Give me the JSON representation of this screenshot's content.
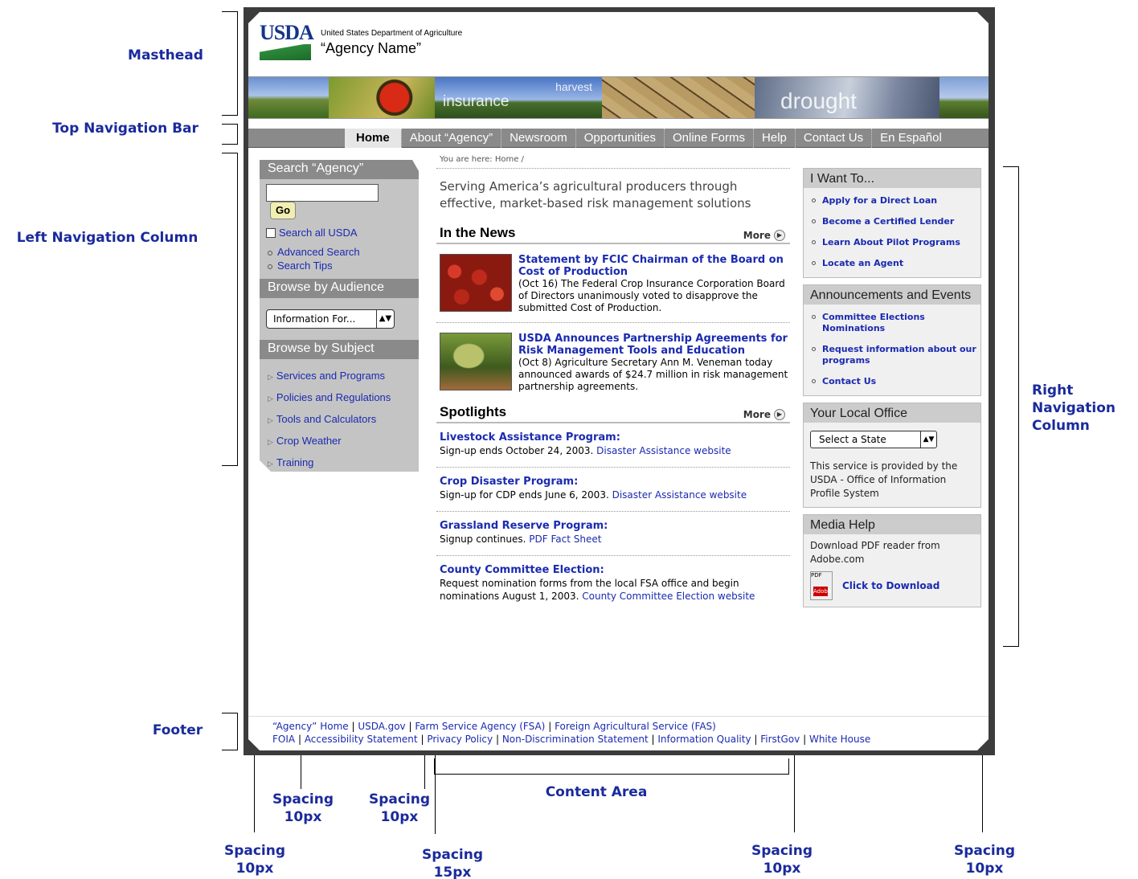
{
  "annotations": {
    "masthead": "Masthead",
    "top_nav": "Top Navigation Bar",
    "left_nav": "Left Navigation Column",
    "footer": "Footer",
    "right_nav": [
      "Right",
      "Navigation",
      "Column"
    ],
    "content_area": "Content Area",
    "spacing": [
      {
        "label": "Spacing",
        "value": "10px"
      },
      {
        "label": "Spacing",
        "value": "10px"
      },
      {
        "label": "Spacing",
        "value": "10px"
      },
      {
        "label": "Spacing",
        "value": "15px"
      },
      {
        "label": "Spacing",
        "value": "10px"
      },
      {
        "label": "Spacing",
        "value": "10px"
      }
    ]
  },
  "masthead": {
    "logo_text": "USDA",
    "department": "United States Department of Agriculture",
    "agency": "“Agency Name”",
    "banner_words": {
      "insurance": "insurance",
      "harvest": "harvest",
      "drought": "drought"
    }
  },
  "top_nav": {
    "items": [
      "Home",
      "About “Agency”",
      "Newsroom",
      "Opportunities",
      "Online Forms",
      "Help",
      "Contact Us",
      "En Español"
    ]
  },
  "left_nav": {
    "search_heading": "Search “Agency”",
    "go_label": "Go",
    "search_all": "Search all USDA",
    "links": [
      "Advanced Search",
      "Search Tips"
    ],
    "audience_heading": "Browse by Audience",
    "audience_select": "Information For...",
    "subject_heading": "Browse by Subject",
    "subjects": [
      "Services and Programs",
      "Policies and Regulations",
      "Tools and Calculators",
      "Crop Weather",
      "Training"
    ]
  },
  "content": {
    "breadcrumb": "You are here: Home /",
    "tagline": "Serving America’s agricultural producers through effective, market-based risk management solutions",
    "news_heading": "In the News",
    "more_label": "More",
    "news": [
      {
        "title": "Statement by FCIC Chairman of the Board on Cost of Production",
        "body": "(Oct 16) The Federal Crop Insurance Corporation Board of Directors unanimously voted to disapprove the submitted Cost of Production."
      },
      {
        "title": "USDA Announces Partnership Agreements for Risk Management Tools and Education",
        "body": "(Oct 8) Agriculture Secretary Ann M. Veneman today announced awards of $24.7 million in risk management partnership agreements."
      }
    ],
    "spotlights_heading": "Spotlights",
    "spotlights": [
      {
        "title": "Livestock Assistance Program:",
        "body": "Sign-up ends October 24, 2003.",
        "link": "Disaster Assistance website"
      },
      {
        "title": "Crop Disaster Program:",
        "body": "Sign-up for CDP ends June 6, 2003.",
        "link": "Disaster Assistance website"
      },
      {
        "title": "Grassland Reserve Program:",
        "body": "Signup continues.",
        "link": "PDF Fact Sheet"
      },
      {
        "title": "County Committee Election:",
        "body": "Request nomination forms from the local FSA office and begin nominations August 1, 2003.",
        "link": "County Committee Election website"
      }
    ]
  },
  "right_nav": {
    "want_heading": "I Want To...",
    "want_items": [
      "Apply for a Direct Loan",
      "Become a Certified Lender",
      "Learn About Pilot Programs",
      "Locate an Agent"
    ],
    "announce_heading": "Announcements and Events",
    "announce_items": [
      "Committee Elections Nominations",
      "Request information about our programs",
      "Contact Us"
    ],
    "office_heading": "Your Local Office",
    "state_select": "Select a State",
    "office_note": "This service is provided by the USDA - Office of Information Profile System",
    "media_heading": "Media Help",
    "media_note": "Download PDF reader from Adobe.com",
    "pdf_icon_label": "PDF",
    "pdf_icon_brand": "Adobe",
    "download_link": "Click to Download"
  },
  "footer": {
    "row1": [
      "“Agency” Home",
      "USDA.gov",
      "Farm Service Agency (FSA)",
      "Foreign Agricultural Service (FAS)"
    ],
    "row2": [
      "FOIA",
      "Accessibility Statement",
      "Privacy Policy",
      "Non-Discrimination Statement",
      "Information Quality",
      "FirstGov",
      "White House"
    ]
  },
  "colors": {
    "link": "#1a2ab0",
    "annotation": "#1a2a9c",
    "nav_gray": "#8a8a8a",
    "frame": "#3c3c3c"
  }
}
